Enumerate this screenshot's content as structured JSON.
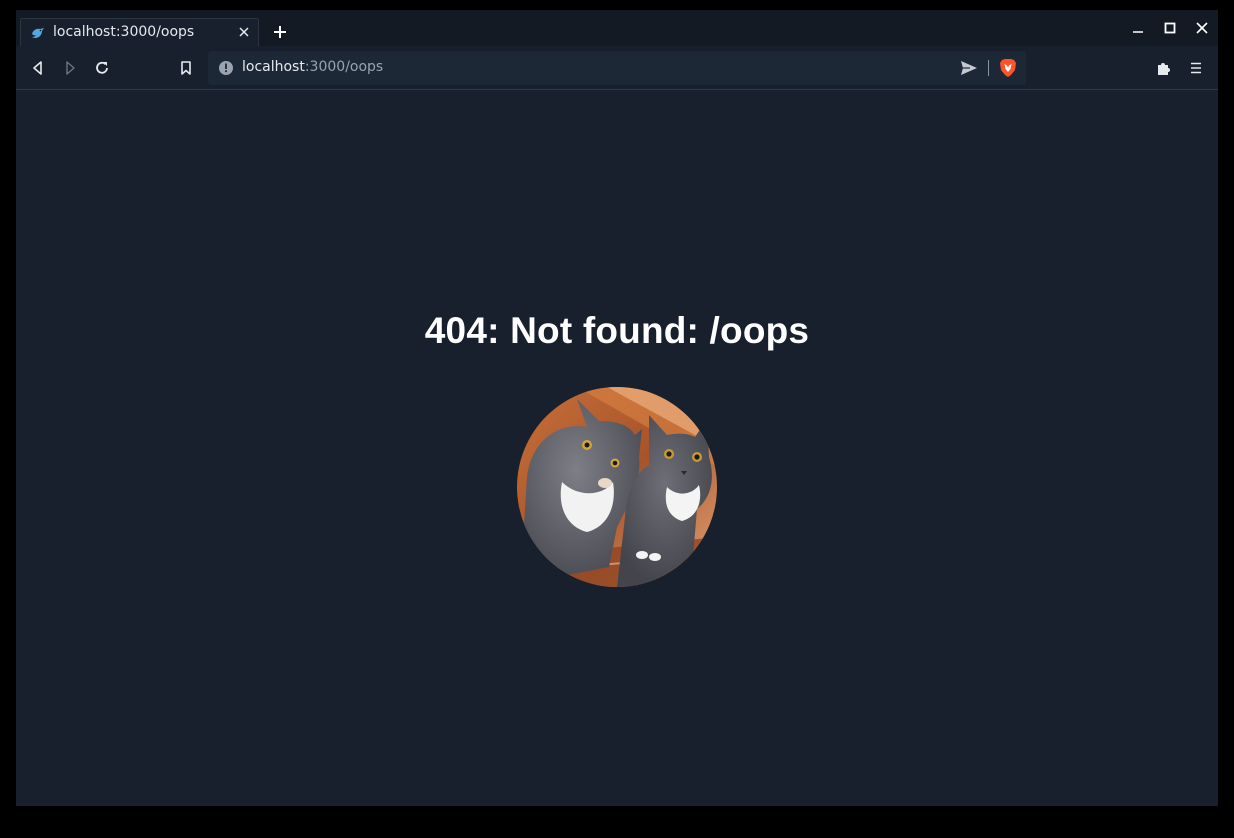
{
  "tab": {
    "title": "localhost:3000/oops",
    "favicon": "bird-icon"
  },
  "omnibox": {
    "host": "localhost",
    "path": ":3000/oops"
  },
  "page": {
    "heading": "404: Not found: /oops",
    "image_alt": "two-gray-cats-photo"
  },
  "icons": {
    "back": "back-arrow-icon",
    "forward": "forward-arrow-icon",
    "reload": "reload-icon",
    "bookmark": "bookmark-icon",
    "info": "info-icon",
    "send": "send-icon",
    "brave": "brave-lion-icon",
    "extensions": "puzzle-icon",
    "menu": "hamburger-menu-icon",
    "minimize": "minimize-icon",
    "maximize": "maximize-icon",
    "close": "close-icon"
  },
  "colors": {
    "page_bg": "#17202c",
    "text": "#ffffff",
    "accent_brave": "#fb542b"
  }
}
